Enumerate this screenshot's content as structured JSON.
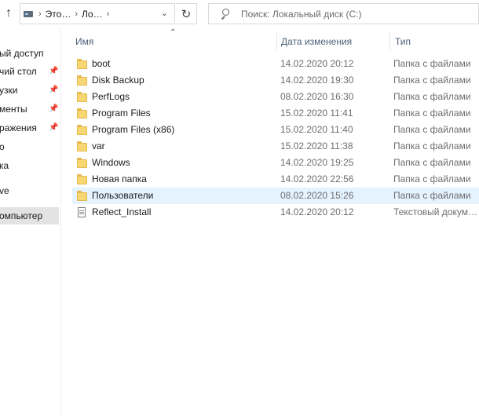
{
  "toolbar": {
    "breadcrumbs": [
      "Это…",
      "Ло…"
    ],
    "search_placeholder": "Поиск: Локальный диск (C:)"
  },
  "sidebar": {
    "items": [
      {
        "label": "ый доступ",
        "pinned": false
      },
      {
        "label": "чий стол",
        "pinned": true
      },
      {
        "label": "узки",
        "pinned": true
      },
      {
        "label": "менты",
        "pinned": true
      },
      {
        "label": "ражения",
        "pinned": true
      },
      {
        "label": "о",
        "pinned": false
      },
      {
        "label": "ка",
        "pinned": false
      },
      {
        "label": "ve",
        "pinned": false
      },
      {
        "label": "омпьютер",
        "pinned": false,
        "selected": true
      }
    ]
  },
  "columns": {
    "name": "Имя",
    "date": "Дата изменения",
    "type": "Тип"
  },
  "files": [
    {
      "name": "boot",
      "date": "14.02.2020 20:12",
      "type": "Папка с файлами",
      "icon": "folder-icon"
    },
    {
      "name": "Disk Backup",
      "date": "14.02.2020 19:30",
      "type": "Папка с файлами",
      "icon": "folder-icon"
    },
    {
      "name": "PerfLogs",
      "date": "08.02.2020 16:30",
      "type": "Папка с файлами",
      "icon": "folder-icon"
    },
    {
      "name": "Program Files",
      "date": "15.02.2020 11:41",
      "type": "Папка с файлами",
      "icon": "folder-icon"
    },
    {
      "name": "Program Files (x86)",
      "date": "15.02.2020 11:40",
      "type": "Папка с файлами",
      "icon": "folder-icon"
    },
    {
      "name": "var",
      "date": "15.02.2020 11:38",
      "type": "Папка с файлами",
      "icon": "folder-icon"
    },
    {
      "name": "Windows",
      "date": "14.02.2020 19:25",
      "type": "Папка с файлами",
      "icon": "folder-icon"
    },
    {
      "name": "Новая папка",
      "date": "14.02.2020 22:56",
      "type": "Папка с файлами",
      "icon": "folder-icon"
    },
    {
      "name": "Пользователи",
      "date": "08.02.2020 15:26",
      "type": "Папка с файлами",
      "icon": "folder-icon",
      "hovered": true
    },
    {
      "name": "Reflect_Install",
      "date": "14.02.2020 20:12",
      "type": "Текстовый докум…",
      "icon": "document-icon"
    }
  ]
}
